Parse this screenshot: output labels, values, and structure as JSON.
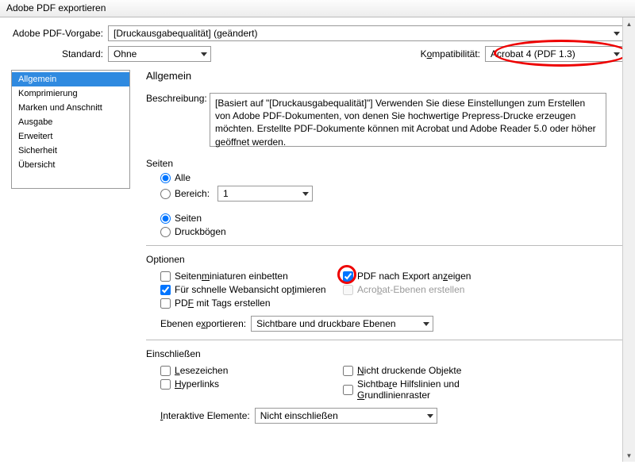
{
  "window": {
    "title": "Adobe PDF exportieren"
  },
  "top": {
    "preset_label": "Adobe PDF-Vorgabe:",
    "preset_value": "[Druckausgabequalität] (geändert)",
    "standard_label": "Standard:",
    "standard_value": "Ohne",
    "compat_label_pre": "K",
    "compat_label_mid": "o",
    "compat_label_post": "mpatibilität:",
    "compat_value": "Acrobat 4 (PDF 1.3)"
  },
  "sidebar": {
    "items": [
      {
        "label": "Allgemein",
        "selected": true
      },
      {
        "label": "Komprimierung"
      },
      {
        "label": "Marken und Anschnitt"
      },
      {
        "label": "Ausgabe"
      },
      {
        "label": "Erweitert"
      },
      {
        "label": "Sicherheit"
      },
      {
        "label": "Übersicht"
      }
    ]
  },
  "general": {
    "heading": "Allgemein",
    "desc_label": "Beschreibung:",
    "desc_text": "[Basiert auf \"[Druckausgabequalität]\"] Verwenden Sie diese Einstellungen zum Erstellen von Adobe PDF-Dokumenten, von denen Sie hochwertige Prepress-Drucke erzeugen möchten. Erstellte PDF-Dokumente können mit Acrobat und Adobe Reader 5.0 oder höher geöffnet werden.",
    "pages_heading": "Seiten",
    "radio_all": "Alle",
    "radio_range": "Bereich:",
    "range_value": "1",
    "radio_pages": "Seiten",
    "radio_spreads": "Druckbögen",
    "options_heading": "Optionen",
    "opt_thumbs_pre": "Seiten",
    "opt_thumbs_u": "m",
    "opt_thumbs_post": "iniaturen einbetten",
    "opt_view_pre": "PDF nach Export an",
    "opt_view_u": "z",
    "opt_view_post": "eigen",
    "opt_fastweb_pre": "Für schnelle Webansicht op",
    "opt_fastweb_u": "t",
    "opt_fastweb_post": "imieren",
    "opt_layers_pre": "Acro",
    "opt_layers_u": "b",
    "opt_layers_post": "at-Ebenen erstellen",
    "opt_tagged_pre": "PD",
    "opt_tagged_u": "F",
    "opt_tagged_post": " mit Tags erstellen",
    "export_layers_label_pre": "Ebenen e",
    "export_layers_label_u": "x",
    "export_layers_label_post": "portieren:",
    "export_layers_value": "Sichtbare und druckbare Ebenen",
    "include_heading": "Einschließen",
    "inc_bookmarks_pre": "",
    "inc_bookmarks_u": "L",
    "inc_bookmarks_post": "esezeichen",
    "inc_nonprint_pre": "",
    "inc_nonprint_u": "N",
    "inc_nonprint_post": "icht druckende Objekte",
    "inc_hyperlinks_pre": "",
    "inc_hyperlinks_u": "H",
    "inc_hyperlinks_post": "yperlinks",
    "inc_guides_pre": "Sichtba",
    "inc_guides_u": "r",
    "inc_guides_post": "e Hilfslinien und ",
    "inc_guides_u2": "G",
    "inc_guides_post2": "rundlinienraster",
    "interactive_label_pre": "",
    "interactive_label_u": "I",
    "interactive_label_post": "nteraktive Elemente:",
    "interactive_value": "Nicht einschließen"
  }
}
